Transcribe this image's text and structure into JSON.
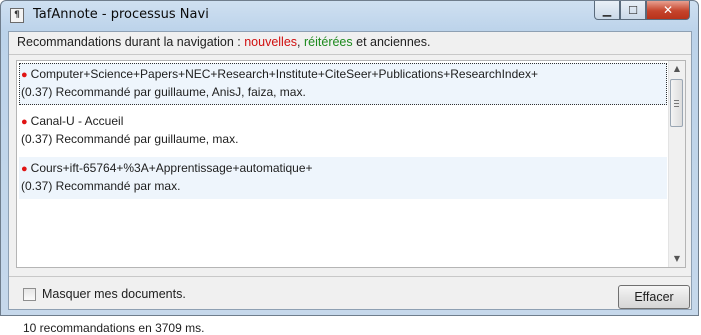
{
  "window": {
    "title": "TafAnnote - processus Navi",
    "icon": "tafannote-app-icon",
    "controls": {
      "minimize": "minimize-icon",
      "maximize": "maximize-icon",
      "close": "close-icon"
    }
  },
  "header": {
    "prefix": "Recommandations durant la navigation : ",
    "new_label": "nouvelles",
    "sep": ", ",
    "repeated_label": "réitérées",
    "suffix": " et anciennes.",
    "colors": {
      "new": "#d01010",
      "repeated": "#1d8a1d"
    }
  },
  "recommendations": [
    {
      "title": "Computer+Science+Papers+NEC+Research+Institute+CiteSeer+Publications+ResearchIndex+",
      "detail": "(0.37) Recommandé par guillaume, AnisJ, faiza, max.",
      "status": "new"
    },
    {
      "title": "Canal-U - Accueil",
      "detail": "(0.37) Recommandé par guillaume, max.",
      "status": "new"
    },
    {
      "title": "Cours+ift-65764+%3A+Apprentissage+automatique+",
      "detail": "(0.37) Recommandé par max.",
      "status": "new"
    }
  ],
  "options": {
    "hide_my_docs_label": "Masquer mes documents.",
    "hide_my_docs_checked": false
  },
  "status_text": "10 recommandations en 3709 ms.",
  "clear_button_label": "Effacer"
}
